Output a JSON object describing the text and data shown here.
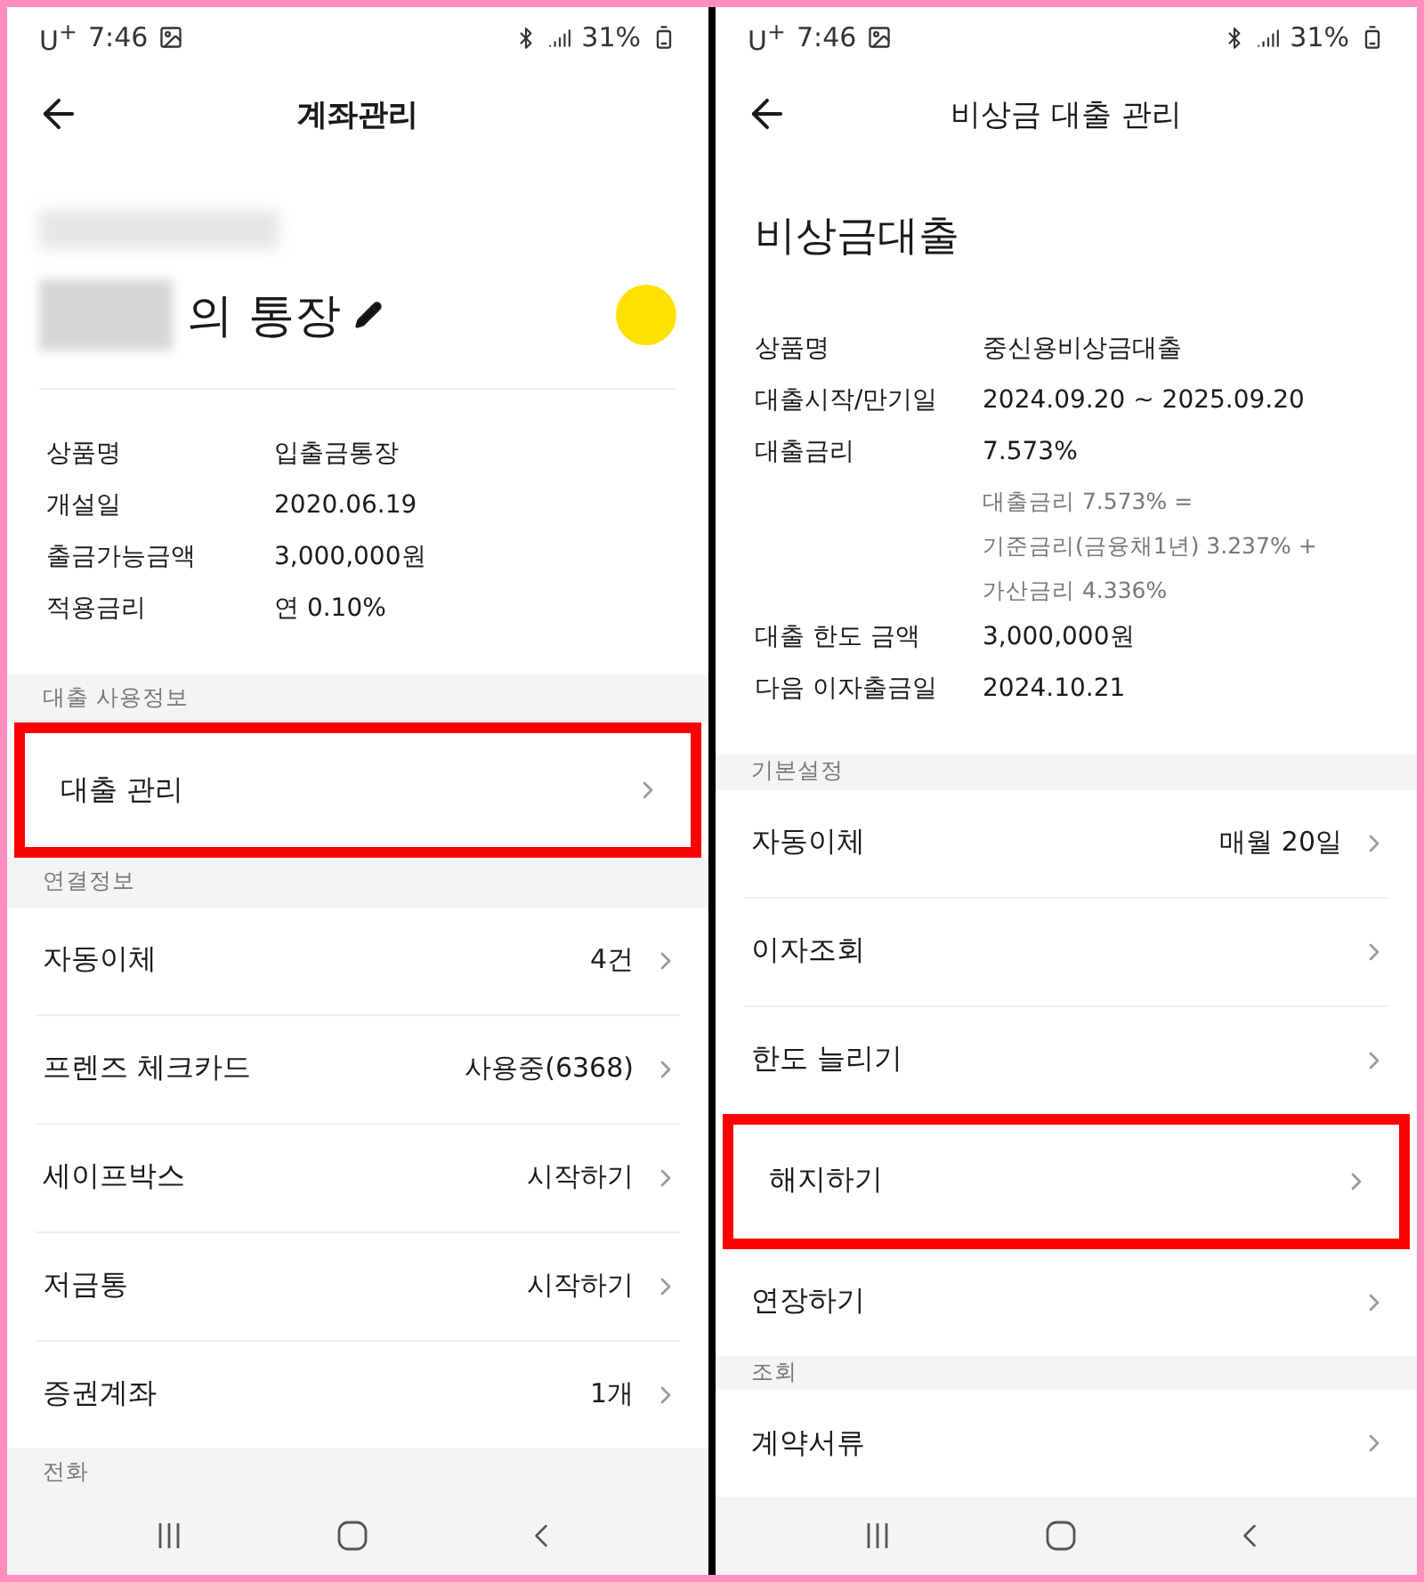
{
  "panels": [
    {
      "status_bar": {
        "carrier": "U$^{+}$",
        "time": "7:46",
        "battery": "31%"
      },
      "header": {
        "title": "계좌관리",
        "bold": true
      },
      "blocks": [
        {
          "kind": "account",
          "suffix": "의 통장",
          "color": "#ffe100"
        },
        {
          "kind": "info",
          "rows": [
            {
              "label": "상품명",
              "value": "입출금통장"
            },
            {
              "label": "개설일",
              "value": "2020.06.19"
            },
            {
              "label": "출금가능금액",
              "value": "3,000,000원"
            },
            {
              "label": "적용금리",
              "value": "연 0.10%"
            }
          ]
        },
        {
          "kind": "section",
          "label": "대출 사용정보"
        },
        {
          "kind": "menu",
          "items": [
            {
              "label": "대출 관리",
              "highlighted": true
            }
          ]
        },
        {
          "kind": "section",
          "label": "연결정보"
        },
        {
          "kind": "menu",
          "items": [
            {
              "label": "자동이체",
              "value": "4건",
              "highlighted": false
            },
            {
              "label": "프렌즈 체크카드",
              "value": "사용중(6368)",
              "highlighted": false
            },
            {
              "label": "세이프박스",
              "value": "시작하기",
              "highlighted": false
            },
            {
              "label": "저금통",
              "value": "시작하기",
              "highlighted": false
            },
            {
              "label": "증권계좌",
              "value": "1개",
              "highlighted": false
            }
          ]
        },
        {
          "kind": "section",
          "label": "전화"
        }
      ]
    },
    {
      "status_bar": {
        "carrier": "U$^{+}$",
        "time": "7:46",
        "battery": "31%"
      },
      "header": {
        "title": "비상금 대출 관리",
        "bold": false
      },
      "blocks": [
        {
          "kind": "title",
          "text": "비상금대출"
        },
        {
          "kind": "info",
          "rows": [
            {
              "label": "상품명",
              "value": "중신용비상금대출"
            },
            {
              "label": "대출시작/만기일",
              "value": "2024.09.20 ~ 2025.09.20"
            },
            {
              "label": "대출금리",
              "value": "7.573%",
              "notes": [
                "대출금리 7.573% =",
                "기준금리(금융채1년) 3.237% +",
                "가산금리 4.336%"
              ]
            },
            {
              "label": "대출 한도 금액",
              "value": "3,000,000원"
            },
            {
              "label": "다음 이자출금일",
              "value": "2024.10.21"
            }
          ]
        },
        {
          "kind": "section",
          "label": "기본설정"
        },
        {
          "kind": "menu",
          "items": [
            {
              "label": "자동이체",
              "value": "매월 20일",
              "highlighted": false
            },
            {
              "label": "이자조회",
              "highlighted": false
            },
            {
              "label": "한도 늘리기",
              "highlighted": false
            },
            {
              "label": "해지하기",
              "highlighted": true
            },
            {
              "label": "연장하기",
              "highlighted": false
            }
          ]
        },
        {
          "kind": "section",
          "label": "조회"
        },
        {
          "kind": "menu",
          "items": [
            {
              "label": "계약서류",
              "highlighted": false
            }
          ]
        }
      ]
    }
  ]
}
